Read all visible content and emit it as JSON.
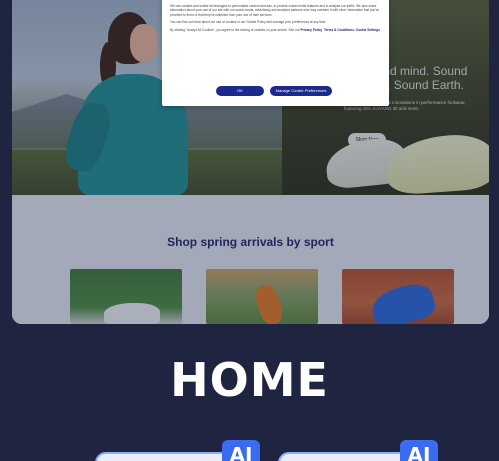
{
  "hero": {
    "headline": "Sound mind. Sound body. Sound Earth.",
    "body": "Our newest sustainable innovations in performance footwear, featuring GEL-KAYANO 30 and more.",
    "cta_label": "Shop Now"
  },
  "section": {
    "title": "Shop spring arrivals by sport"
  },
  "cookie_dialog": {
    "paragraph_1": "We use cookies and similar technologies to personalise content and ads, to provide social media features and to analyse our traffic. We also share information about your use of our site with our social media, advertising and analytics partners who may combine it with other information that you've provided to them or that they've collected from your use of their services.",
    "paragraph_2": "You can find out more about our use of cookies in our Cookie Policy and manage your preferences at any time.",
    "paragraph_3_prefix": "By clicking \"Accept All Cookies\", you agree to the storing of cookies on your device. See our",
    "link_privacy": "Privacy Policy",
    "link_terms": "Terms & Conditions",
    "link_settings": "Cookie Settings",
    "accept_label": "OK",
    "manage_label": "Manage Cookie Preferences"
  },
  "page_title": "HOME",
  "badges": {
    "ai_1": "AI",
    "ai_2": "AI"
  },
  "colors": {
    "background": "#1f2440",
    "accent_blue": "#3b6bf0",
    "brand_navy": "#1c2a6b",
    "hero_runner_top": "#1e8f93"
  }
}
